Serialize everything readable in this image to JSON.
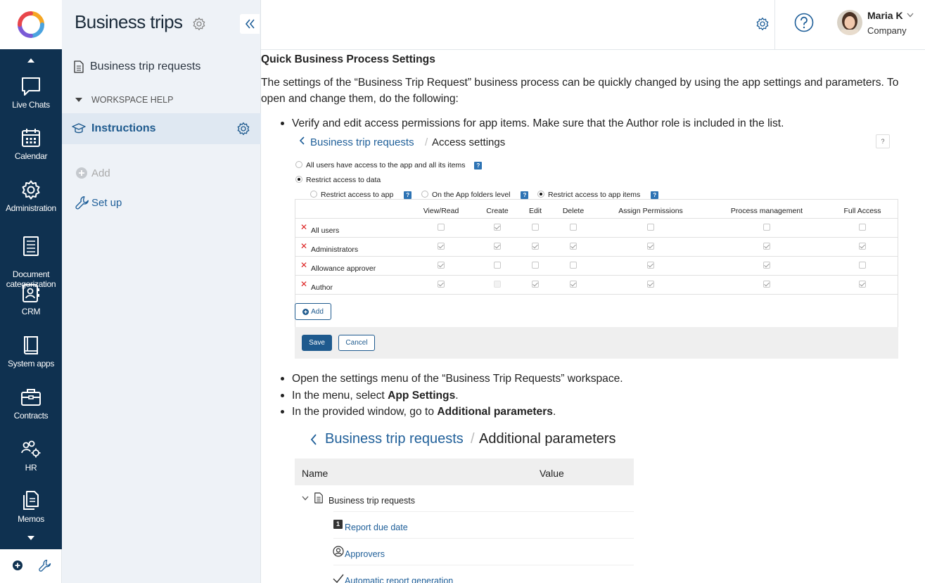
{
  "rail": {
    "items": [
      {
        "label": "Live Chats",
        "icon": "chat-icon"
      },
      {
        "label": "Calendar",
        "icon": "calendar-icon"
      },
      {
        "label": "Administration",
        "icon": "gear-icon"
      },
      {
        "label": "Document\ncategorization",
        "icon": "document-icon"
      },
      {
        "label": "CRM",
        "icon": "crm-icon"
      },
      {
        "label": "System apps",
        "icon": "book-icon"
      },
      {
        "label": "Contracts",
        "icon": "briefcase-icon"
      },
      {
        "label": "HR",
        "icon": "people-gear-icon"
      },
      {
        "label": "Memos",
        "icon": "memos-icon"
      }
    ]
  },
  "panel": {
    "title": "Business trips",
    "items": {
      "requests": "Business trip requests",
      "section": "WORKSPACE HELP",
      "instructions": "Instructions",
      "add": "Add",
      "setup": "Set up"
    }
  },
  "user": {
    "name": "Maria K",
    "company": "Company"
  },
  "content": {
    "heading": "Quick Business Process Settings",
    "intro": "The settings of the “Business Trip Request” business process can be quickly changed by using the app settings and parameters. To open and change them, do the following:",
    "bullet1": "Verify and edit access permissions for app items. Make sure that the Author role is included in the list.",
    "bullet2": "Open the settings menu of the “Business Trip Requests” workspace.",
    "bullet3_pre": "In the menu, select ",
    "bullet3_bold": "App Settings",
    "bullet3_post": ".",
    "bullet4_pre": "In the provided window, go to ",
    "bullet4_bold": "Additional parameters",
    "bullet4_post": "."
  },
  "access": {
    "breadcrumb_link": "Business trip requests",
    "breadcrumb_sep": "/",
    "breadcrumb_current": "Access settings",
    "opt_all": "All users have access to the app and all its items",
    "opt_restrict": "Restrict access to data",
    "sub_app": "Restrict access to app",
    "sub_folders": "On the App folders level",
    "sub_items": "Restrict access to app items",
    "q": "?",
    "columns": [
      "View/Read",
      "Create",
      "Edit",
      "Delete",
      "Assign Permissions",
      "Process management",
      "Full Access"
    ],
    "rows": [
      {
        "name": "All users",
        "checks": [
          0,
          1,
          0,
          0,
          0,
          0,
          0
        ]
      },
      {
        "name": "Administrators",
        "checks": [
          1,
          1,
          1,
          1,
          1,
          1,
          1
        ]
      },
      {
        "name": "Allowance approver",
        "checks": [
          1,
          0,
          0,
          0,
          1,
          1,
          0
        ]
      },
      {
        "name": "Author",
        "checks": [
          1,
          2,
          1,
          1,
          1,
          1,
          1
        ]
      }
    ],
    "add": "Add",
    "save": "Save",
    "cancel": "Cancel"
  },
  "params": {
    "breadcrumb_link": "Business trip requests",
    "breadcrumb_sep": "/",
    "breadcrumb_current": "Additional parameters",
    "col_name": "Name",
    "col_value": "Value",
    "group": "Business trip requests",
    "items": [
      "Report due date",
      "Approvers",
      "Automatic report generation"
    ],
    "number_badge": "1"
  },
  "colors": {
    "rail": "#0f3150",
    "panel": "#eef2f7",
    "link": "#1f5f99",
    "primary": "#1e5a8e"
  }
}
